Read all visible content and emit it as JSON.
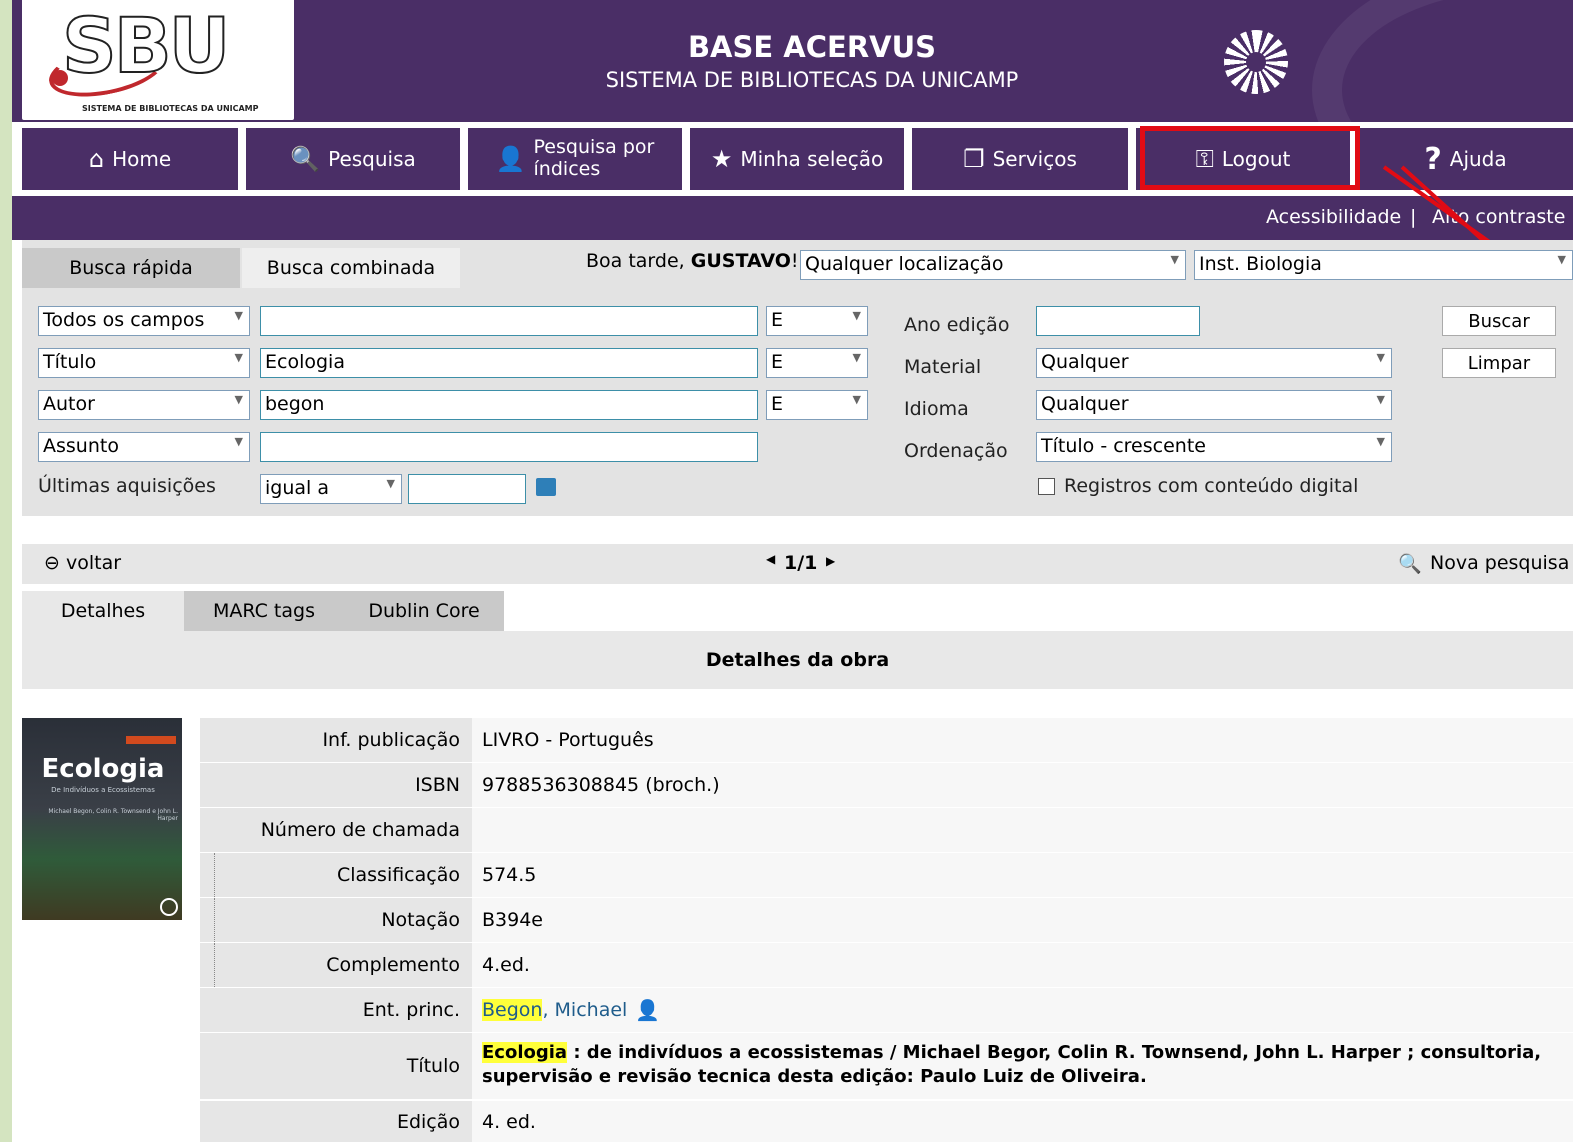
{
  "header": {
    "logo_text": "SBU",
    "logo_subtitle": "SISTEMA DE BIBLIOTECAS DA UNICAMP",
    "title": "BASE ACERVUS",
    "subtitle": "SISTEMA DE BIBLIOTECAS DA UNICAMP"
  },
  "nav": {
    "home": "Home",
    "pesquisa": "Pesquisa",
    "indices_line1": "Pesquisa por",
    "indices_line2": "índices",
    "selecao": "Minha seleção",
    "servicos": "Serviços",
    "logout": "Logout",
    "ajuda": "Ajuda"
  },
  "accessibility": {
    "acessibilidade": "Acessibilidade",
    "separator": "|",
    "alto_contraste": "Alto contraste"
  },
  "search": {
    "tab_rapida": "Busca rápida",
    "tab_combinada": "Busca combinada",
    "greeting_prefix": "Boa tarde, ",
    "user": "GUSTAVO",
    "greeting_suffix": "!",
    "location": "Qualquer localização",
    "library": "Inst. Biologia",
    "fields": [
      {
        "field": "Todos os campos",
        "value": "",
        "op": "E"
      },
      {
        "field": "Título",
        "value": "Ecologia",
        "op": "E"
      },
      {
        "field": "Autor",
        "value": "begon",
        "op": "E"
      },
      {
        "field": "Assunto",
        "value": ""
      }
    ],
    "ultimas_label": "Últimas aquisições",
    "ultimas_op": "igual a",
    "ultimas_value": "",
    "ano_label": "Ano edição",
    "ano_value": "",
    "material_label": "Material",
    "material_value": "Qualquer",
    "idioma_label": "Idioma",
    "idioma_value": "Qualquer",
    "ordenacao_label": "Ordenação",
    "ordenacao_value": "Título - crescente",
    "digital_label": "Registros com conteúdo digital",
    "buscar": "Buscar",
    "limpar": "Limpar"
  },
  "result_nav": {
    "voltar": "voltar",
    "pager": "1/1",
    "nova": "Nova pesquisa"
  },
  "detail_tabs": [
    "Detalhes",
    "MARC tags",
    "Dublin Core"
  ],
  "details_title": "Detalhes da obra",
  "cover": {
    "title": "Ecologia",
    "subtitle": "De Indivíduos a Ecossistemas",
    "authors": "Michael Begon, Colin R. Townsend e John L. Harper"
  },
  "record": {
    "inf_pub_label": "Inf. publicação",
    "inf_pub": "LIVRO - Português",
    "isbn_label": "ISBN",
    "isbn": "9788536308845 (broch.)",
    "chamada_label": "Número de chamada",
    "chamada": "",
    "classif_label": "Classificação",
    "classif": "574.5",
    "notacao_label": "Notação",
    "notacao": "B394e",
    "complemento_label": "Complemento",
    "complemento": "4.ed.",
    "ent_label": "Ent. princ.",
    "ent_surname": "Begon",
    "ent_rest": ", Michael",
    "titulo_label": "Título",
    "titulo_hl": "Ecologia",
    "titulo_rest1": " : de indivíduos a ecossistemas / Michael Begor, Colin R. Townsend, John L. Harper ; consultoria,",
    "titulo_rest2": "supervisão e revisão tecnica desta edição: Paulo Luiz de Oliveira.",
    "edicao_label": "Edição",
    "edicao": "4. ed."
  },
  "colors": {
    "header": "#4a2e66",
    "highlight_box": "#e10b14",
    "search_highlight": "#ffff3a"
  }
}
